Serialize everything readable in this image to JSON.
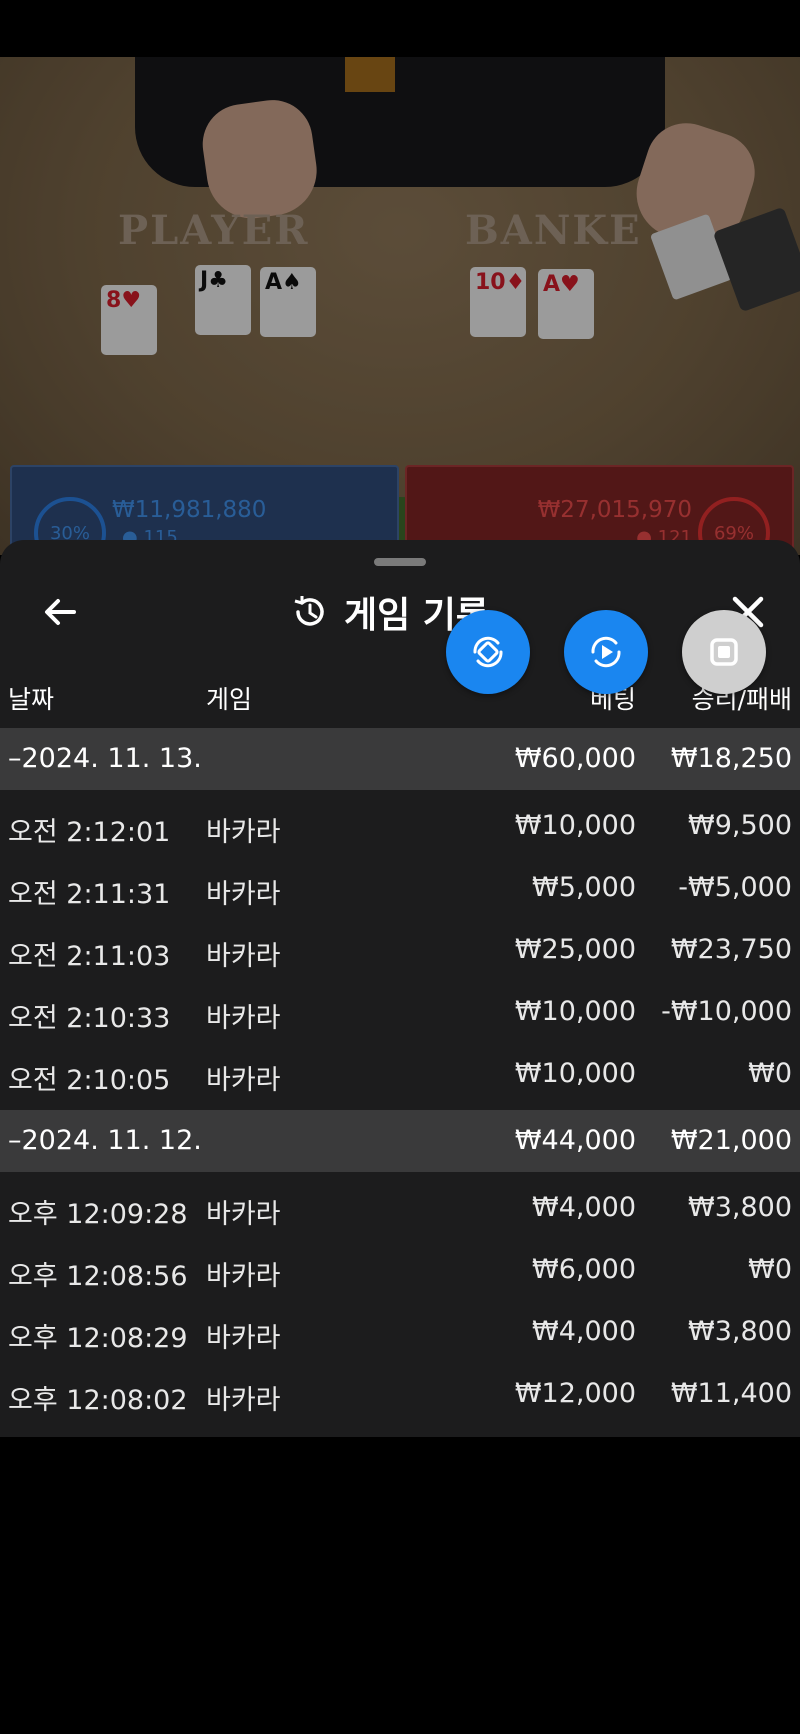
{
  "video": {
    "player_label": "PLAYER",
    "banker_label": "BANKE",
    "player_cards": [
      {
        "rank": "8",
        "suit": "♥",
        "color": "red"
      },
      {
        "rank": "J",
        "suit": "♣",
        "color": "blk"
      },
      {
        "rank": "A",
        "suit": "♠",
        "color": "blk"
      }
    ],
    "banker_cards": [
      {
        "rank": "10",
        "suit": "♦",
        "color": "red"
      },
      {
        "rank": "A",
        "suit": "♥",
        "color": "red"
      }
    ],
    "player_panel": {
      "percent": "30%",
      "amount": "₩11,981,880",
      "count": "115"
    },
    "banker_panel": {
      "percent": "69%",
      "amount": "₩27,015,970",
      "count": "121"
    }
  },
  "sheet": {
    "title": "게임 기록",
    "icons": {
      "back": "arrow-left-icon",
      "history": "history-icon",
      "close": "close-icon"
    },
    "columns": {
      "date": "날짜",
      "game": "게임",
      "bet": "베팅",
      "result": "승리/패배"
    },
    "groups": [
      {
        "label": "–2024. 11. 13.",
        "bet_total": "₩60,000",
        "result_total": "₩18,250",
        "rows": [
          {
            "time": "오전 2:12:01",
            "game": "바카라",
            "bet": "₩10,000",
            "result": "₩9,500"
          },
          {
            "time": "오전 2:11:31",
            "game": "바카라",
            "bet": "₩5,000",
            "result": "-₩5,000"
          },
          {
            "time": "오전 2:11:03",
            "game": "바카라",
            "bet": "₩25,000",
            "result": "₩23,750"
          },
          {
            "time": "오전 2:10:33",
            "game": "바카라",
            "bet": "₩10,000",
            "result": "-₩10,000"
          },
          {
            "time": "오전 2:10:05",
            "game": "바카라",
            "bet": "₩10,000",
            "result": "₩0"
          }
        ]
      },
      {
        "label": "–2024. 11. 12.",
        "bet_total": "₩44,000",
        "result_total": "₩21,000",
        "rows": [
          {
            "time": "오후 12:09:28",
            "game": "바카라",
            "bet": "₩4,000",
            "result": "₩3,800"
          },
          {
            "time": "오후 12:08:56",
            "game": "바카라",
            "bet": "₩6,000",
            "result": "₩0"
          },
          {
            "time": "오후 12:08:29",
            "game": "바카라",
            "bet": "₩4,000",
            "result": "₩3,800"
          },
          {
            "time": "오후 12:08:02",
            "game": "바카라",
            "bet": "₩12,000",
            "result": "₩11,400"
          }
        ]
      }
    ]
  },
  "floating_controls": {
    "rotate": "rotate-screen-icon",
    "replay": "replay-icon",
    "stop": "stop-icon",
    "colors": {
      "blue": "#1a86f0",
      "grey": "#cfcfcf"
    }
  }
}
